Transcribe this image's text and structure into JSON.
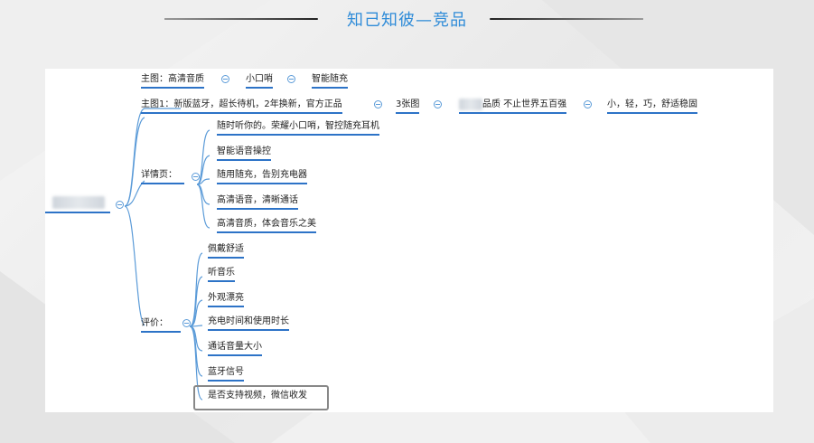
{
  "slide": {
    "title": "知己知彼—竞品"
  },
  "mindmap": {
    "root_label": "",
    "branches": {
      "main_image": {
        "label": "主图：高清音质",
        "children": [
          "小口哨",
          "智能随充"
        ]
      },
      "main_image_1": {
        "label": "主图1：新版蓝牙，超长待机，2年换新，官方正品",
        "children": [
          "3张图",
          "品质 不止世界五百强",
          "小，轻，巧，舒适稳固"
        ]
      },
      "details": {
        "label": "详情页：",
        "children": [
          "随时听你的。荣耀小口哨，智控随充耳机",
          "智能语音操控",
          "随用随充，告别充电器",
          "高清语音，清晰通话",
          "高清音质，体会音乐之美"
        ]
      },
      "reviews": {
        "label": "评价：",
        "children": [
          "佩戴舒适",
          "听音乐",
          "外观漂亮",
          "充电时间和使用时长",
          "通话音量大小",
          "蓝牙信号",
          "是否支持视频，微信收发"
        ]
      }
    },
    "colors": {
      "accent": "#2d73c7",
      "connector": "#5b9bd8",
      "title": "#2e8bd8"
    }
  }
}
